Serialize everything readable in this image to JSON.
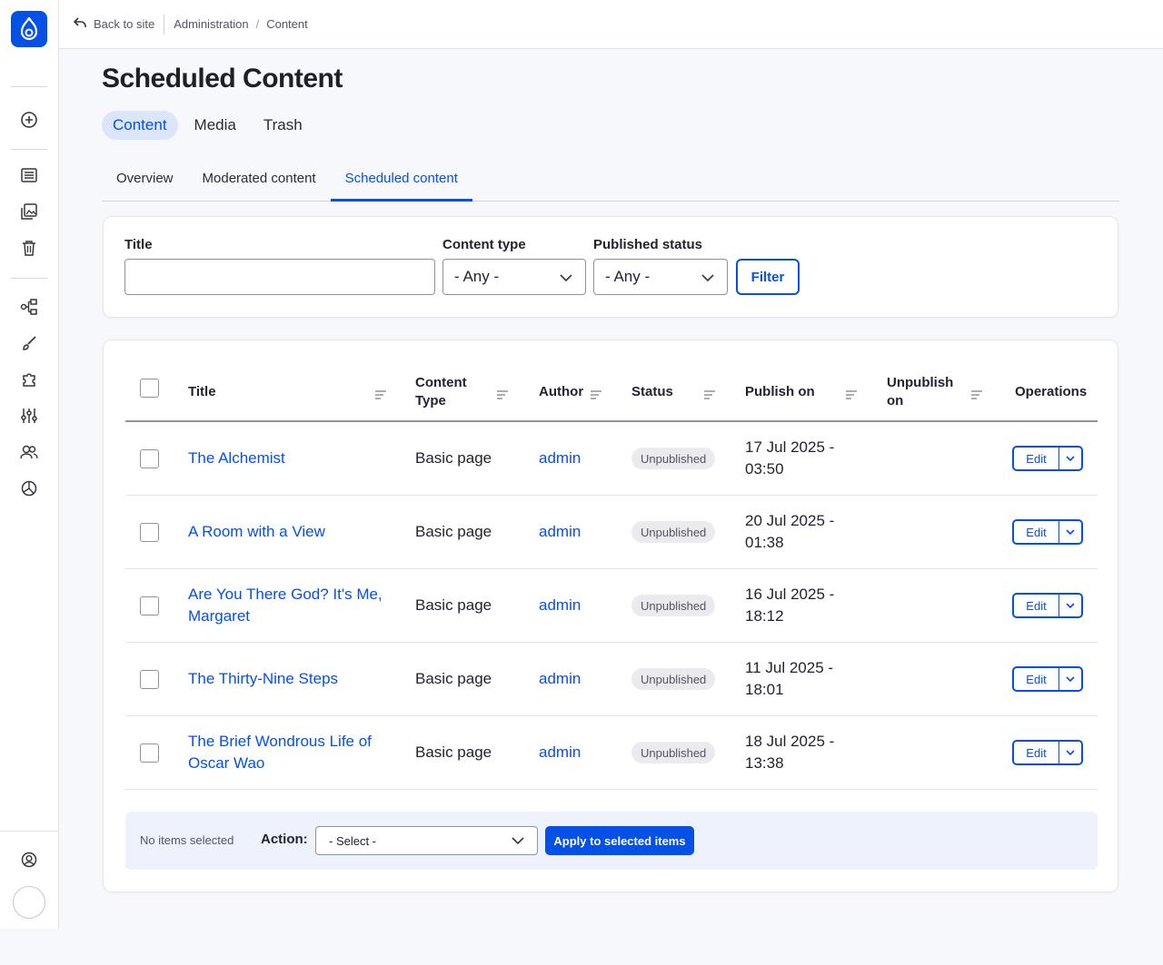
{
  "topbar": {
    "back_label": "Back to site",
    "breadcrumbs": [
      "Administration",
      "Content"
    ],
    "breadcrumb_separator": "/"
  },
  "page": {
    "title": "Scheduled Content"
  },
  "primary_tabs": [
    {
      "label": "Content",
      "active": true
    },
    {
      "label": "Media",
      "active": false
    },
    {
      "label": "Trash",
      "active": false
    }
  ],
  "secondary_tabs": [
    {
      "label": "Overview",
      "active": false
    },
    {
      "label": "Moderated content",
      "active": false
    },
    {
      "label": "Scheduled content",
      "active": true
    }
  ],
  "filters": {
    "title_label": "Title",
    "title_value": "",
    "content_type_label": "Content type",
    "content_type_value": "- Any -",
    "status_label": "Published status",
    "status_value": "- Any -",
    "filter_button": "Filter"
  },
  "table": {
    "headers": {
      "title": "Title",
      "content_type_line1": "Content",
      "content_type_line2": "Type",
      "author": "Author",
      "status": "Status",
      "publish_on": "Publish on",
      "unpublish_on_line1": "Unpublish",
      "unpublish_on_line2": "on",
      "operations": "Operations"
    },
    "rows": [
      {
        "title_line1": "The Alchemist",
        "title_line2": "",
        "type": "Basic page",
        "author": "admin",
        "status": "Unpublished",
        "publish_line1": "17 Jul 2025 -",
        "publish_line2": "03:50",
        "unpublish": "",
        "edit": "Edit"
      },
      {
        "title_line1": "A Room with a View",
        "title_line2": "",
        "type": "Basic page",
        "author": "admin",
        "status": "Unpublished",
        "publish_line1": "20 Jul 2025 -",
        "publish_line2": "01:38",
        "unpublish": "",
        "edit": "Edit"
      },
      {
        "title_line1": "Are You There God? It's Me,",
        "title_line2": "Margaret",
        "type": "Basic page",
        "author": "admin",
        "status": "Unpublished",
        "publish_line1": "16 Jul 2025 -",
        "publish_line2": "18:12",
        "unpublish": "",
        "edit": "Edit"
      },
      {
        "title_line1": "The Thirty-Nine Steps",
        "title_line2": "",
        "type": "Basic page",
        "author": "admin",
        "status": "Unpublished",
        "publish_line1": "11 Jul 2025 -",
        "publish_line2": "18:01",
        "unpublish": "",
        "edit": "Edit"
      },
      {
        "title_line1": "The Brief Wondrous Life of",
        "title_line2": "Oscar Wao",
        "type": "Basic page",
        "author": "admin",
        "status": "Unpublished",
        "publish_line1": "18 Jul 2025 -",
        "publish_line2": "13:38",
        "unpublish": "",
        "edit": "Edit"
      }
    ]
  },
  "bulk": {
    "status": "No items selected",
    "action_label": "Action:",
    "select_value": "- Select -",
    "apply_button": "Apply to selected items"
  },
  "sidebar_icons": [
    "drupal-logo-icon",
    "add-content-icon",
    "content-icon",
    "media-icon",
    "trash-icon",
    "structure-icon",
    "appearance-icon",
    "extend-icon",
    "configuration-icon",
    "people-icon",
    "reports-icon",
    "user-account-icon"
  ],
  "colors": {
    "accent": "#0550e6",
    "accent_tint": "#dbe6fb",
    "badge_bg": "#ebebef",
    "page_bg": "#f7f8fc"
  }
}
